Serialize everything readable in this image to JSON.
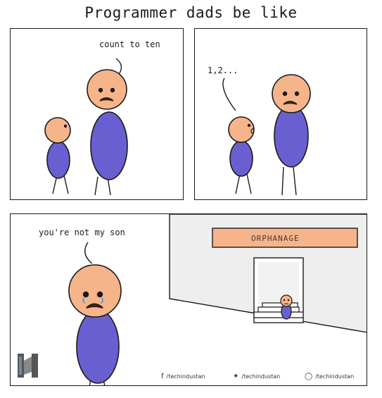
{
  "title": "Programmer dads be like",
  "panels": [
    {
      "speech": "count to ten"
    },
    {
      "speech": "1,2..."
    },
    {
      "speech": "you're not my son",
      "sign": "ORPHANAGE"
    }
  ],
  "footer": {
    "facebook": "/techindustan",
    "twitter": "/techindustan",
    "instagram": "/techindustan"
  },
  "colors": {
    "body": "#6a5fd0",
    "skin": "#f6b48a",
    "outline": "#1a1a1a",
    "sign": "#f6b48a",
    "wall": "#eeeeee"
  },
  "icons": [
    "facebook-icon",
    "twitter-icon",
    "instagram-icon",
    "logo-icon"
  ]
}
